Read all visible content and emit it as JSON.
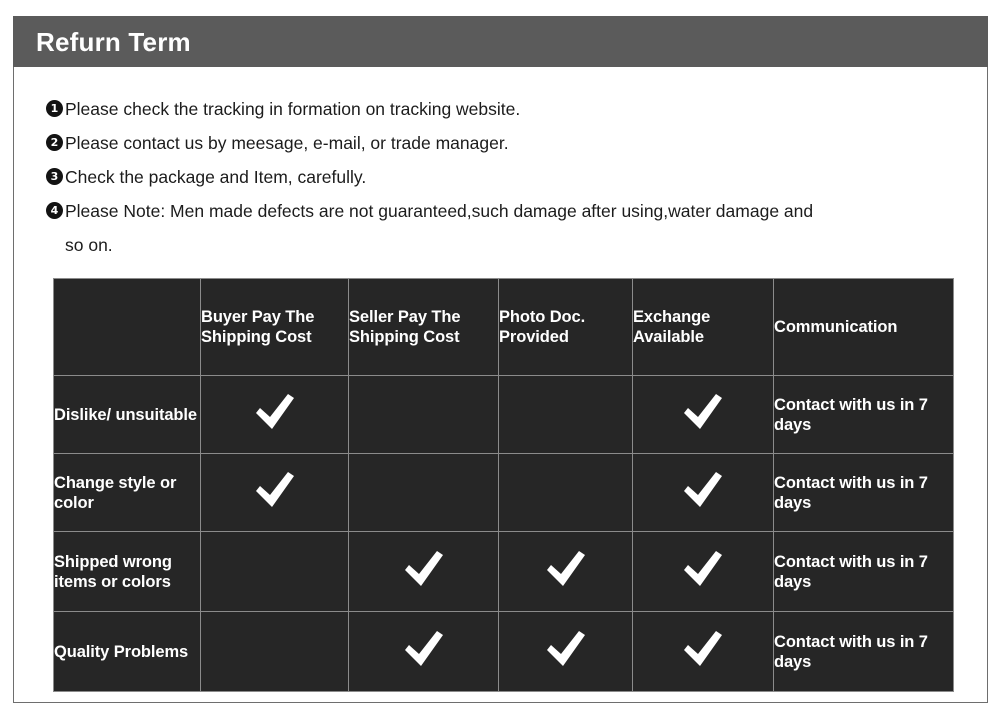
{
  "header": {
    "title": "Refurn Term",
    "bg_color": "#5b5b5b",
    "text_color": "#ffffff"
  },
  "notes": {
    "items": [
      {
        "num": "1",
        "text": "Please check the tracking in formation on tracking website."
      },
      {
        "num": "2",
        "text": "Please contact us by meesage, e-mail, or trade manager."
      },
      {
        "num": "3",
        "text": "Check the package and Item, carefully."
      },
      {
        "num": "4",
        "text": "Please Note: Men made defects  are not guaranteed,such damage after using,water damage and"
      }
    ],
    "continuation": "so on."
  },
  "table": {
    "headers": [
      "",
      "Buyer Pay The Shipping Cost",
      "Seller Pay The Shipping Cost",
      "Photo Doc. Provided",
      "Exchange Available",
      "Communication"
    ],
    "rows": [
      {
        "label": "Dislike/ unsuitable",
        "buyer_pay": "check",
        "seller_pay": "",
        "photo_doc": "",
        "exchange": "check",
        "communication": "Contact with us in 7 days"
      },
      {
        "label": "Change style or color",
        "buyer_pay": "check",
        "seller_pay": "",
        "photo_doc": "",
        "exchange": "check",
        "communication": "Contact with us in 7 days"
      },
      {
        "label": "Shipped wrong items or colors",
        "buyer_pay": "",
        "seller_pay": "check",
        "photo_doc": "check",
        "exchange": "check",
        "communication": "Contact with us in 7 days"
      },
      {
        "label": "Quality Problems",
        "buyer_pay": "",
        "seller_pay": "check",
        "photo_doc": "check",
        "exchange": "check",
        "communication": "Contact with us in 7 days"
      }
    ],
    "cell_bg_color": "#262626",
    "grid_color": "#8b8b8b",
    "text_color": "#ffffff"
  }
}
